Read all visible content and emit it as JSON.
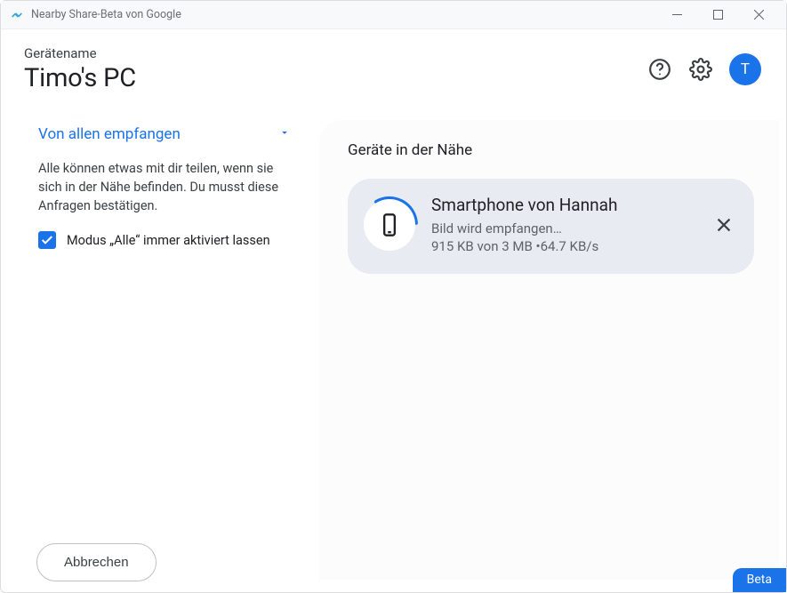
{
  "window": {
    "title": "Nearby Share-Beta von Google"
  },
  "header": {
    "label": "Gerätename",
    "device_name": "Timo's PC",
    "avatar_initial": "T"
  },
  "sidebar": {
    "dropdown_label": "Von allen empfangen",
    "description": "Alle können etwas mit dir teilen, wenn sie sich in der Nähe befinden. Du musst diese Anfragen bestätigen.",
    "checkbox_label": "Modus „Alle“ immer aktiviert lassen",
    "checkbox_checked": true,
    "cancel_label": "Abbrechen"
  },
  "main": {
    "title": "Geräte in der Nähe",
    "device": {
      "name": "Smartphone von Hannah",
      "status": "Bild wird empfangen…",
      "progress_text": "915 KB von 3 MB •64.7 KB/s",
      "received_kb": 915,
      "total_mb": 3,
      "rate_kbs": 64.7
    }
  },
  "badge": {
    "text": "Beta"
  }
}
